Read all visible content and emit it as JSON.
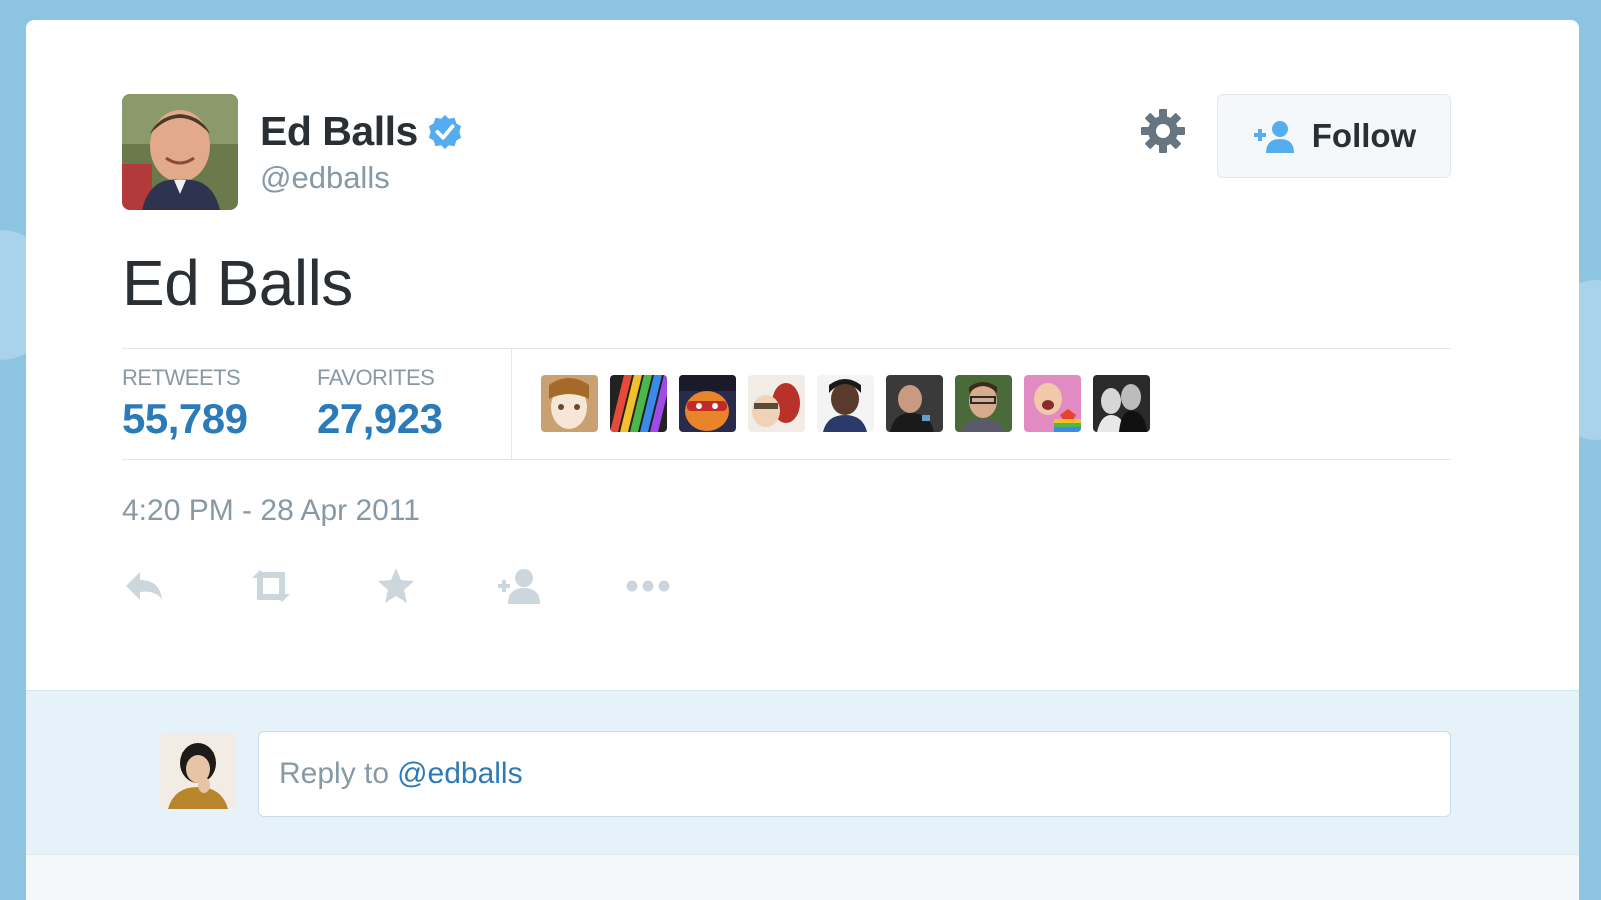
{
  "user": {
    "name": "Ed Balls",
    "handle": "@edballs",
    "verified_icon": "verified-badge-icon",
    "verified_color": "#55acee"
  },
  "header": {
    "settings_icon": "gear-icon",
    "follow_label": "Follow",
    "follow_icon": "add-user-icon"
  },
  "tweet": {
    "text": "Ed Balls",
    "timestamp": "4:20 PM - 28 Apr 2011"
  },
  "stats": {
    "retweets_label": "RETWEETS",
    "retweets_value": "55,789",
    "favorites_label": "FAVORITES",
    "favorites_value": "27,923",
    "favoriter_avatar_count": 9
  },
  "actions": [
    {
      "name": "reply-icon"
    },
    {
      "name": "retweet-icon"
    },
    {
      "name": "favorite-star-icon"
    },
    {
      "name": "add-user-icon"
    },
    {
      "name": "more-icon"
    }
  ],
  "reply": {
    "prefix": "Reply to",
    "mention": "@edballs"
  },
  "colors": {
    "link_blue": "#2b7bb9",
    "muted_gray": "#8899a6",
    "text_dark": "#292f33",
    "reply_bg": "#e6f2f9",
    "page_bg": "#8cc4e2"
  }
}
